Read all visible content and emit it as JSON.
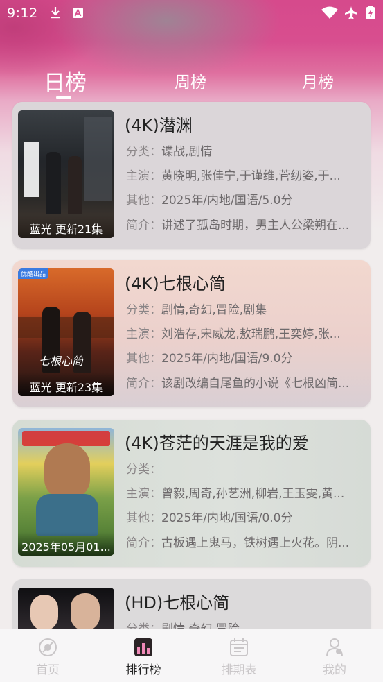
{
  "status_bar": {
    "time": "9:12",
    "icons": [
      "download-icon",
      "app-a-icon",
      "wifi-icon",
      "airplane-icon",
      "battery-charging-icon"
    ]
  },
  "tabs": [
    {
      "label": "日榜",
      "active": true
    },
    {
      "label": "周榜",
      "active": false
    },
    {
      "label": "月榜",
      "active": false
    }
  ],
  "colors": {
    "header_pink": "#d84e8f",
    "active_nav": "#d84e8f",
    "inactive_nav": "#c9c6c8"
  },
  "labels": {
    "category": "分类：",
    "cast": "主演：",
    "other": "其他：",
    "intro": "简介："
  },
  "items": [
    {
      "title": "(4K)潜渊",
      "poster_caption": "蓝光 更新21集",
      "category": "谍战,剧情",
      "cast": "黄晓明,张佳宁,于谨维,菅纫姿,于...",
      "other": "2025年/内地/国语/5.0分",
      "intro": "讲述了孤岛时期，男主人公梁朔在..."
    },
    {
      "title": "(4K)七根心简",
      "poster_caption": "蓝光 更新23集",
      "poster_tag": "优酷出品",
      "category": "剧情,奇幻,冒险,剧集",
      "cast": "刘浩存,宋威龙,敖瑞鹏,王奕婷,张...",
      "other": "2025年/内地/国语/9.0分",
      "intro": "该剧改编自尾鱼的小说《七根凶简..."
    },
    {
      "title": "(4K)苍茫的天涯是我的爱",
      "poster_caption": "2025年05月01...",
      "category": "",
      "cast": "曾毅,周奇,孙艺洲,柳岩,王玉雯,黄...",
      "other": "2025年/内地/国语/0.0分",
      "intro": "古板遇上鬼马，铁树遇上火花。阴..."
    },
    {
      "title": "(HD)七根心简",
      "category": "剧情,奇幻,冒险"
    }
  ],
  "bottom_nav": [
    {
      "label": "首页",
      "icon": "home-icon",
      "active": false
    },
    {
      "label": "排行榜",
      "icon": "ranking-icon",
      "active": true
    },
    {
      "label": "排期表",
      "icon": "calendar-icon",
      "active": false
    },
    {
      "label": "我的",
      "icon": "profile-icon",
      "active": false
    }
  ]
}
